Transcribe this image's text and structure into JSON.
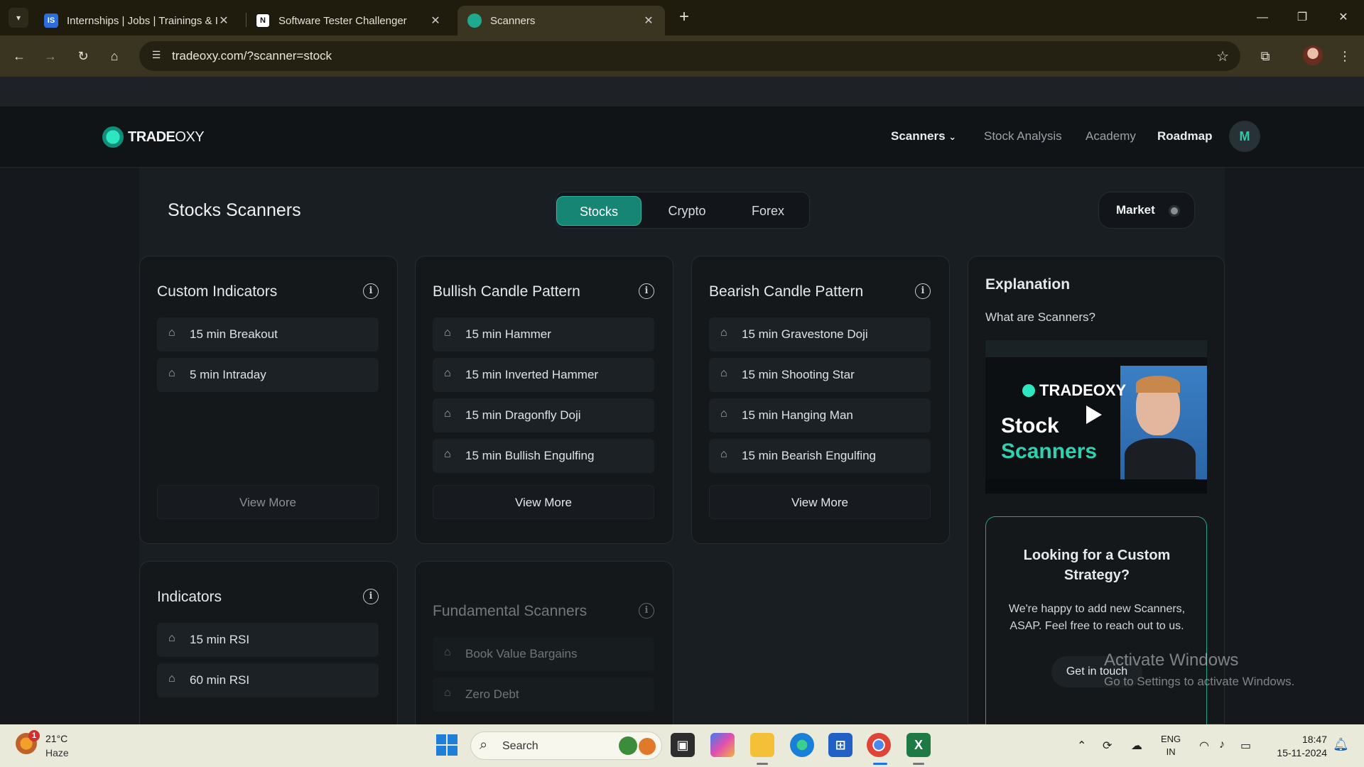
{
  "browser": {
    "tabs": [
      {
        "title": "Internships | Jobs | Trainings & I",
        "favicon": "IS"
      },
      {
        "title": "Software Tester Challenger",
        "favicon": "N"
      },
      {
        "title": "Scanners",
        "favicon": ""
      }
    ],
    "url": "tradeoxy.com/?scanner=stock"
  },
  "site": {
    "logo_bold": "TRADE",
    "logo_light": "OXY",
    "nav": {
      "scanners": "Scanners",
      "stock_analysis": "Stock Analysis",
      "academy": "Academy",
      "roadmap": "Roadmap"
    },
    "avatar_initial": "M"
  },
  "page": {
    "title": "Stocks Scanners",
    "segments": [
      "Stocks",
      "Crypto",
      "Forex"
    ],
    "active_segment": "Stocks",
    "market_label": "Market",
    "info_glyph": "i"
  },
  "cards": {
    "custom": {
      "title": "Custom Indicators",
      "items": [
        "15 min Breakout",
        "5 min Intraday"
      ],
      "view_more": "View More"
    },
    "bullish": {
      "title": "Bullish Candle Pattern",
      "items": [
        "15 min Hammer",
        "15 min Inverted Hammer",
        "15 min Dragonfly Doji",
        "15 min Bullish Engulfing"
      ],
      "view_more": "View More"
    },
    "bearish": {
      "title": "Bearish Candle Pattern",
      "items": [
        "15 min Gravestone Doji",
        "15 min Shooting Star",
        "15 min Hanging Man",
        "15 min Bearish Engulfing"
      ],
      "view_more": "View More"
    },
    "indicators": {
      "title": "Indicators",
      "items": [
        "15 min RSI",
        "60 min RSI"
      ]
    },
    "fundamental": {
      "title": "Fundamental Scanners",
      "items": [
        "Book Value Bargains",
        "Zero Debt"
      ]
    }
  },
  "explanation": {
    "title": "Explanation",
    "question": "What are Scanners?",
    "video": {
      "brand": "TRADEOXY",
      "line1": "Stock",
      "line2": "Scanners"
    },
    "cta": {
      "title": "Looking for a Custom Strategy?",
      "text": "We're happy to add new Scanners, ASAP. Feel free to reach out to us.",
      "button": "Get in touch"
    }
  },
  "watermark": {
    "line1": "Activate Windows",
    "line2": "Go to Settings to activate Windows."
  },
  "taskbar": {
    "weather_temp": "21°C",
    "weather_cond": "Haze",
    "weather_badge": "1",
    "search_placeholder": "Search",
    "lang_line1": "ENG",
    "lang_line2": "IN",
    "time": "18:47",
    "date": "15-11-2024"
  },
  "colors": {
    "accent": "#168574",
    "accent_border": "#1fa58b",
    "chrome": "#3a3520"
  }
}
